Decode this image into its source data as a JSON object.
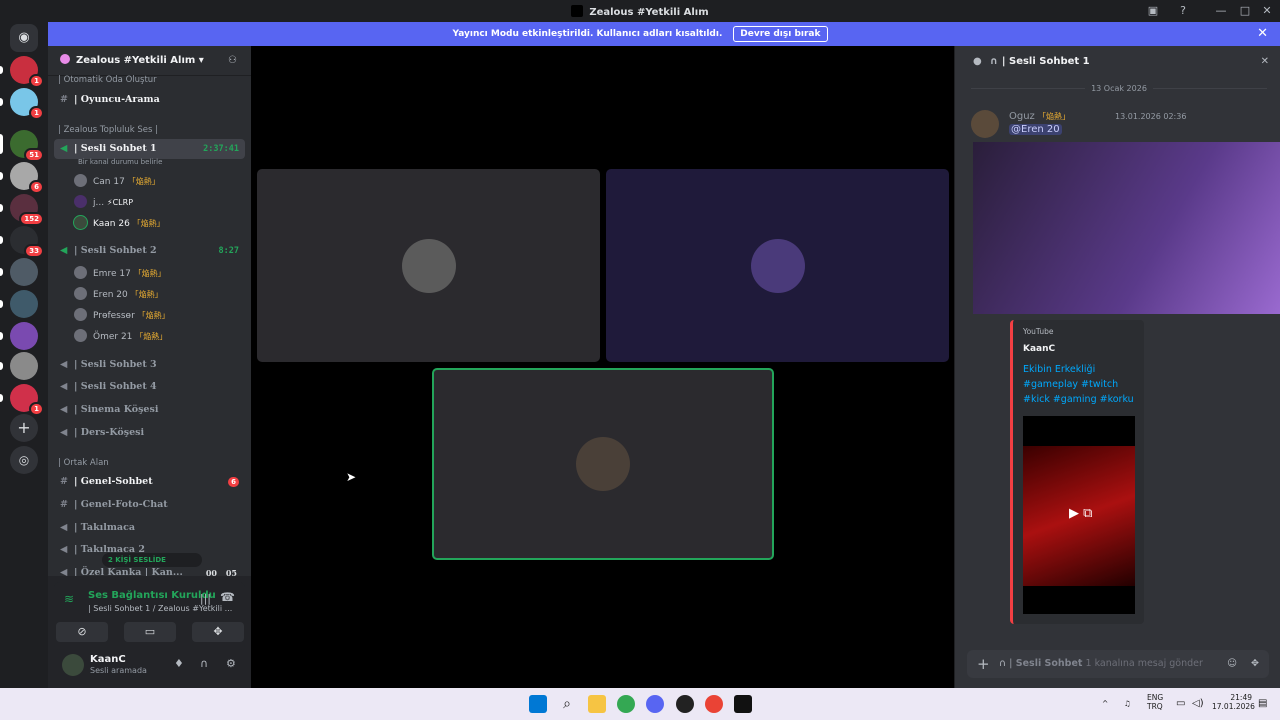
{
  "window": {
    "title": "Zealous #Yetkili Alım"
  },
  "banner": {
    "message": "Yayıncı Modu etkinleştirildi. Kullanıcı adları kısaltıldı.",
    "button": "Devre dışı bırak"
  },
  "servers": [
    {
      "badge": "1",
      "color": "#c92f3f"
    },
    {
      "badge": "1",
      "color": "#79c6e8"
    },
    {
      "badge": "51",
      "color": "#3b6b2f"
    },
    {
      "badge": "6",
      "color": "#a8a8a8"
    },
    {
      "badge": "152",
      "color": "#5a2f3f"
    },
    {
      "badge": "33",
      "color": "#2b2d31"
    },
    {
      "badge": "",
      "color": "#4f5b66"
    },
    {
      "badge": "",
      "color": "#3f5a6a"
    },
    {
      "badge": "",
      "color": "#7a4ab0"
    },
    {
      "badge": "",
      "color": "#8a8a8a"
    },
    {
      "badge": "1",
      "color": "#d0304a"
    }
  ],
  "sidebar": {
    "server_name": "Zealous #Yetkili Alım",
    "cat_top": "| Otomatik Oda Oluştur",
    "ch_oyuncu": "| Oyuncu-Arama",
    "cat_toplu": "| Zealous Topluluk Ses |",
    "vc1": {
      "name": "| Sesli Sohbet 1",
      "time": "2:37:41",
      "status": "Bir kanal durumu belirle"
    },
    "vc1_users": [
      {
        "name": "Can 17",
        "tag": "「焔熱」"
      },
      {
        "name": "j...",
        "tag": "⚡CLRP"
      },
      {
        "name": "Kaan 26",
        "tag": "「焔熱」"
      }
    ],
    "vc2": {
      "name": "| Sesli Sohbet 2",
      "time": "8:27"
    },
    "vc2_users": [
      {
        "name": "Emre 17",
        "tag": "「焔熱」"
      },
      {
        "name": "Eren 20",
        "tag": "「焔熱」"
      },
      {
        "name": "Prөfessөr",
        "tag": "「焔熱」"
      },
      {
        "name": "Ömer 21",
        "tag": "「焔熱」"
      }
    ],
    "vc3": "| Sesli Sohbet 3",
    "vc4": "| Sesli Sohbet 4",
    "sinema": "| Sinema Köşesi",
    "ders": "| Ders-Köşesi",
    "cat_ortak": "| Ortak Alan",
    "genel": "| Genel-Sohbet",
    "genel_badge": "6",
    "foto": "| Genel-Foto-Chat",
    "takil": "| Takılmaca",
    "takil2": "| Takılmaca 2",
    "ozel": "| Özel Kanka | Kan...",
    "ozel_count": "00",
    "ozel_limit": "05",
    "live_pill": "2 KİŞİ SESLİDE"
  },
  "voice_panel": {
    "status": "Ses Bağlantısı Kuruldu",
    "location": "| Sesli Sohbet 1 / Zealous #Yetkili ..."
  },
  "user_panel": {
    "name": "KaanC",
    "status": "Sesli aramada"
  },
  "chat": {
    "title": "| Sesli Sohbet 1",
    "date": "13 Ocak 2026",
    "author": "Oguz",
    "author_tag": "「焔熱」",
    "timestamp": "13.01.2026 02:36",
    "mention": "@Eren 20",
    "embed": {
      "provider": "YouTube",
      "author": "KaanC",
      "title": "Ekibin Erkekliği #gameplay #twitch #kick #gaming #korku"
    },
    "placeholder_channel": "| Sesli Sohbet",
    "placeholder_rest": "1 kanalına mesaj gönder"
  },
  "taskbar": {
    "lang1": "ENG",
    "lang2": "TRQ",
    "time": "21:49",
    "date": "17.01.2026"
  }
}
